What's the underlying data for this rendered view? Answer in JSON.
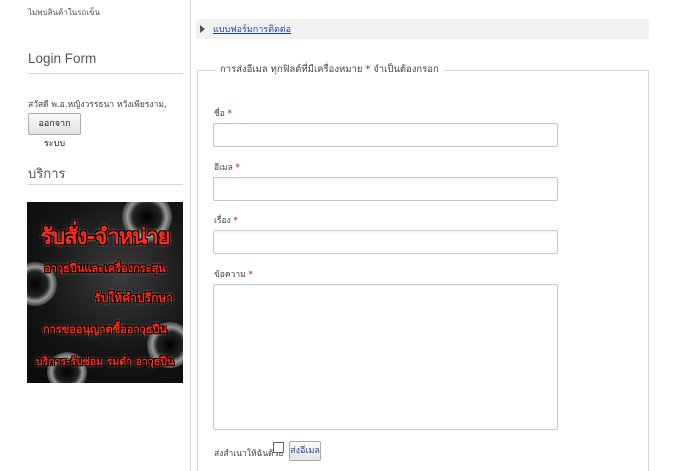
{
  "sidebar": {
    "cart_status": "ไม่พบสินค้าในรถเข็น",
    "login_module": {
      "title": "Login Form",
      "greeting": "สวัสดี พ.อ.หญิงวรรธนา หวังเพียรงาม,",
      "logout_label": "ออกจากระบบ"
    },
    "services_module": {
      "title": "บริการ",
      "banner_lines": [
        "รับสั่ง-จำหน่าย",
        "อาวุธปืนและเครื่องกระสุน",
        "รับให้คำปรึกษา",
        "การขออนุญาตซื้ออาวุธปืน",
        "บริการ-รับซ่อม รมดำ อาวุธปืน"
      ]
    }
  },
  "main": {
    "contact_form_link": "แบบฟอร์มการติดต่อ",
    "form": {
      "legend_text": "การส่งอีเมล ทุกฟิลด์ที่มีเครื่องหมาย ",
      "legend_star": "*",
      "legend_suffix": " จำเป็นต้องกรอก",
      "required_mark": "*",
      "fields": {
        "name_label": "ชื่อ",
        "name_value": "",
        "email_label": "อีเมล",
        "email_value": "",
        "subject_label": "เรื่อง",
        "subject_value": "",
        "message_label": "ข้อความ",
        "message_value": ""
      },
      "send_copy_label": "ส่งสำเนาให้ฉันด้วย",
      "send_copy_checked": false,
      "submit_label": "ส่งอีเมล"
    }
  },
  "colors": {
    "link": "#1a4b9c",
    "required": "#dd0000",
    "banner_text": "#ff2a1a"
  }
}
